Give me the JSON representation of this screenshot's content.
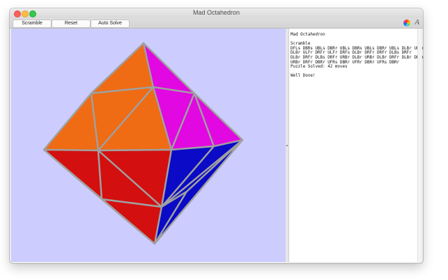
{
  "window": {
    "title": "Mad Octahedron"
  },
  "toolbar": {
    "scramble_label": "Scramble",
    "reset_label": "Reset",
    "auto_solve_label": "Auto Solve",
    "color_icon": "color-wheel-icon",
    "font_icon": "font-icon",
    "font_glyph": "A"
  },
  "log": {
    "text": "Mad Octahedron\n\nScramble\nDFLs DBRs UBLs DBRr UBLs DBRs UBLs DBRr UBLs DLBr ULFr\nDLBr ULFr DRFr ULFr DRFs DLBr DRFr DRFr DLBs DRFr\nDLBr DRFr DLBs DRFr URBr DLBr URBr DLBr DRFr DLBr DRFr\nURBr DRFr DBRr UFRs DBRr UFRr DBRr UFRs DBRr\nPuzzle Solved: 42 moves\n\nWell Done!"
  },
  "colors": {
    "canvas_bg": "#ccccff",
    "orange": "#ef6b14",
    "magenta": "#e108e1",
    "red": "#d40f0f",
    "blue": "#0a0ac7",
    "edge": "#a0a0a0"
  }
}
